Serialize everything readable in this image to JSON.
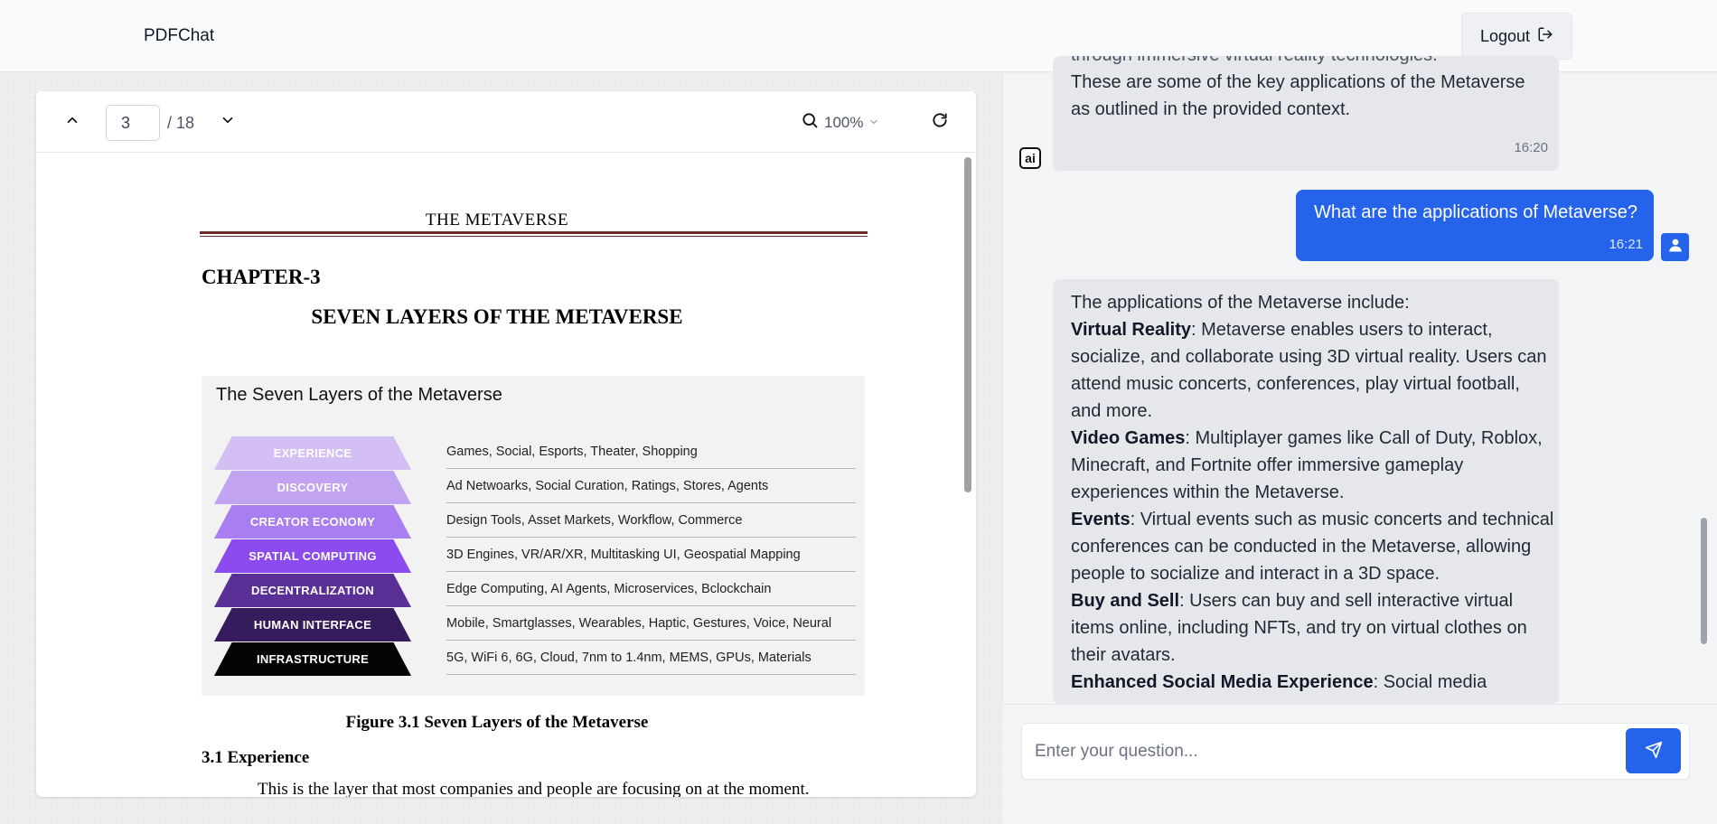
{
  "header": {
    "brand": "PDFChat",
    "logout_label": "Logout"
  },
  "viewer": {
    "current_page": "3",
    "page_total": "/ 18",
    "zoom": "100%",
    "page": {
      "running_head": "THE METAVERSE",
      "chapter": "CHAPTER-3",
      "chapter_title": "SEVEN LAYERS OF THE METAVERSE",
      "figure": {
        "title": "The Seven Layers of the Metaverse",
        "layers": [
          {
            "name": "EXPERIENCE",
            "desc": "Games, Social, Esports, Theater, Shopping",
            "color": "#d3bff3"
          },
          {
            "name": "DISCOVERY",
            "desc": "Ad Netwoarks, Social Curation, Ratings, Stores, Agents",
            "color": "#c2a3f1"
          },
          {
            "name": "CREATOR ECONOMY",
            "desc": "Design Tools, Asset Markets, Workflow, Commerce",
            "color": "#a97ef0"
          },
          {
            "name": "SPATIAL COMPUTING",
            "desc": "3D Engines, VR/AR/XR, Multitasking UI, Geospatial Mapping",
            "color": "#8b4bee"
          },
          {
            "name": "DECENTRALIZATION",
            "desc": "Edge Computing, AI Agents, Microservices, Bclockchain",
            "color": "#5b3096"
          },
          {
            "name": "HUMAN INTERFACE",
            "desc": "Mobile, Smartglasses, Wearables, Haptic, Gestures, Voice, Neural",
            "color": "#361c5c"
          },
          {
            "name": "INFRASTRUCTURE",
            "desc": "5G, WiFi 6, 6G, Cloud, 7nm to 1.4nm, MEMS, GPUs, Materials",
            "color": "#050505"
          }
        ]
      },
      "caption": "Figure 3.1 Seven Layers of the Metaverse",
      "section_heading": "3.1 Experience",
      "paragraph": "This is the layer that most companies and people are focusing on at the moment."
    }
  },
  "chat": {
    "messages": [
      {
        "role": "assistant",
        "lines": [
          "through immersive virtual reality technologies.",
          "These are some of the key applications of the Metaverse",
          "as outlined in the provided context."
        ],
        "time": "16:20"
      },
      {
        "role": "user",
        "text": "What are the applications of Metaverse?",
        "time": "16:21"
      },
      {
        "role": "assistant",
        "intro": "The applications of the Metaverse include:",
        "items": [
          {
            "term": "Virtual Reality",
            "lines": [
              ": Metaverse enables users to interact,",
              "socialize, and collaborate using 3D virtual reality. Users can",
              "attend music concerts, conferences, play virtual football,",
              "and more."
            ]
          },
          {
            "term": "Video Games",
            "lines": [
              ": Multiplayer games like Call of Duty, Roblox,",
              "Minecraft, and Fortnite offer immersive gameplay",
              "experiences within the Metaverse."
            ]
          },
          {
            "term": "Events",
            "lines": [
              ": Virtual events such as music concerts and technical",
              "conferences can be conducted in the Metaverse, allowing",
              "people to socialize and interact in a 3D space."
            ]
          },
          {
            "term": "Buy and Sell",
            "lines": [
              ": Users can buy and sell interactive virtual",
              "items online, including NFTs, and try on virtual clothes on",
              "their avatars."
            ]
          },
          {
            "term": "Enhanced Social Media Experience",
            "lines": [
              ": Social media"
            ]
          }
        ]
      }
    ],
    "composer": {
      "placeholder": "Enter your question..."
    }
  }
}
